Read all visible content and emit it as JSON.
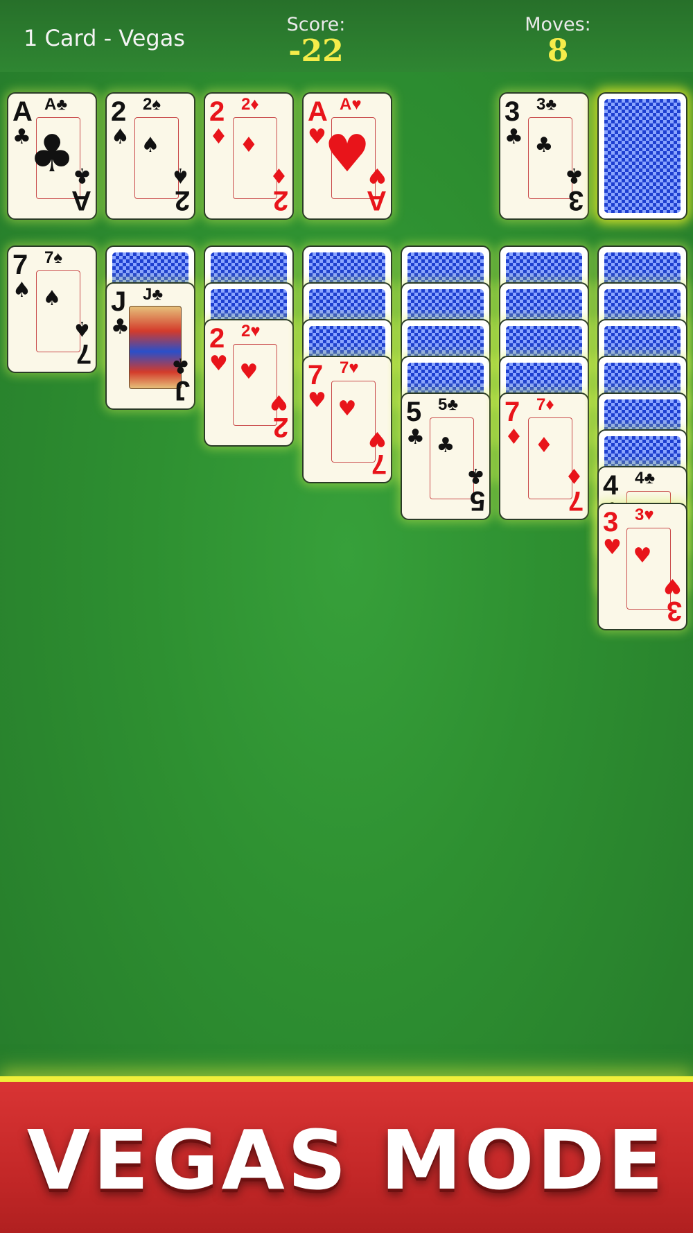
{
  "header": {
    "mode_label": "1 Card - Vegas",
    "score_label": "Score:",
    "score_value": "-22",
    "moves_label": "Moves:",
    "moves_value": "8"
  },
  "foundations": [
    {
      "rank": "A",
      "suit": "♣",
      "color": "black"
    },
    {
      "rank": "2",
      "suit": "♠",
      "color": "black"
    },
    {
      "rank": "2",
      "suit": "♦",
      "color": "red"
    },
    {
      "rank": "A",
      "suit": "♥",
      "color": "red"
    }
  ],
  "waste": {
    "rank": "3",
    "suit": "♣",
    "color": "black"
  },
  "stock": {
    "face_down": true
  },
  "tableau": [
    {
      "face_down": 0,
      "face_up": [
        {
          "rank": "7",
          "suit": "♠",
          "color": "black"
        }
      ]
    },
    {
      "face_down": 1,
      "face_up": [
        {
          "rank": "J",
          "suit": "♣",
          "color": "black",
          "face_card": true
        }
      ]
    },
    {
      "face_down": 2,
      "face_up": [
        {
          "rank": "2",
          "suit": "♥",
          "color": "red"
        }
      ]
    },
    {
      "face_down": 3,
      "face_up": [
        {
          "rank": "7",
          "suit": "♥",
          "color": "red"
        }
      ]
    },
    {
      "face_down": 4,
      "face_up": [
        {
          "rank": "5",
          "suit": "♣",
          "color": "black"
        }
      ]
    },
    {
      "face_down": 4,
      "face_up": [
        {
          "rank": "7",
          "suit": "♦",
          "color": "red"
        }
      ]
    },
    {
      "face_down": 6,
      "face_up": [
        {
          "rank": "4",
          "suit": "♣",
          "color": "black"
        },
        {
          "rank": "3",
          "suit": "♥",
          "color": "red"
        }
      ]
    }
  ],
  "banner": {
    "text": "VEGAS MODE"
  },
  "colors": {
    "felt": "#2e9031",
    "score_yellow": "#f6ec4a",
    "banner_red": "#d93434",
    "glow": "#f0ef3a"
  }
}
